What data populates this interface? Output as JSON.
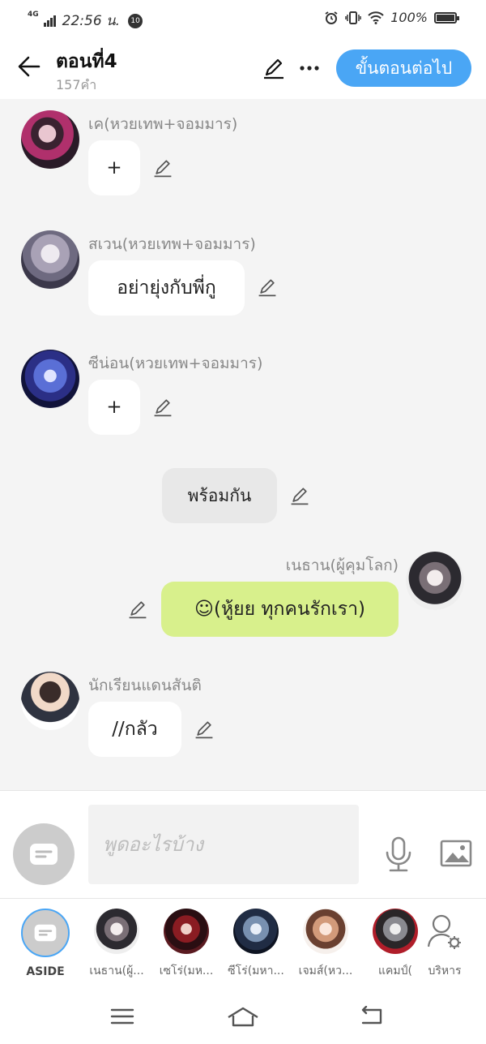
{
  "status": {
    "network": "4G",
    "time": "22:56 น.",
    "notification_count": "10",
    "battery": "100%"
  },
  "header": {
    "title": "ตอนที่4",
    "word_count": "157คำ",
    "next_button": "ขั้นตอนต่อไป"
  },
  "messages": [
    {
      "side": "left",
      "name": "เค(หวยเทพ+จอมมาร)",
      "text": "+"
    },
    {
      "side": "left",
      "name": "สเวน(หวยเทพ+จอมมาร)",
      "text": "อย่ายุ่งกับพี่กู"
    },
    {
      "side": "left",
      "name": "ซีน่อน(หวยเทพ+จอมมาร)",
      "text": "+"
    },
    {
      "side": "center",
      "text": "พร้อมกัน"
    },
    {
      "side": "right",
      "name": "เนธาน(ผู้คุมโลก)",
      "text": "☺(หู้ยย ทุกคนรักเรา)"
    },
    {
      "side": "left",
      "name": "นักเรียนแดนสันติ",
      "text": "//กลัว"
    }
  ],
  "input": {
    "placeholder": "พูดอะไรบ้าง"
  },
  "characters": [
    {
      "label": "ASIDE"
    },
    {
      "label": "เนธาน(ผู้..."
    },
    {
      "label": "เซโร่(มห..."
    },
    {
      "label": "ซีโร่(มหา..."
    },
    {
      "label": "เจมส์(หว..."
    },
    {
      "label": "แคมป์("
    },
    {
      "label": "บริหาร"
    }
  ],
  "colors": {
    "accent": "#4aa6f5",
    "own_bubble": "#d8f08c",
    "background": "#f4f4f4"
  }
}
